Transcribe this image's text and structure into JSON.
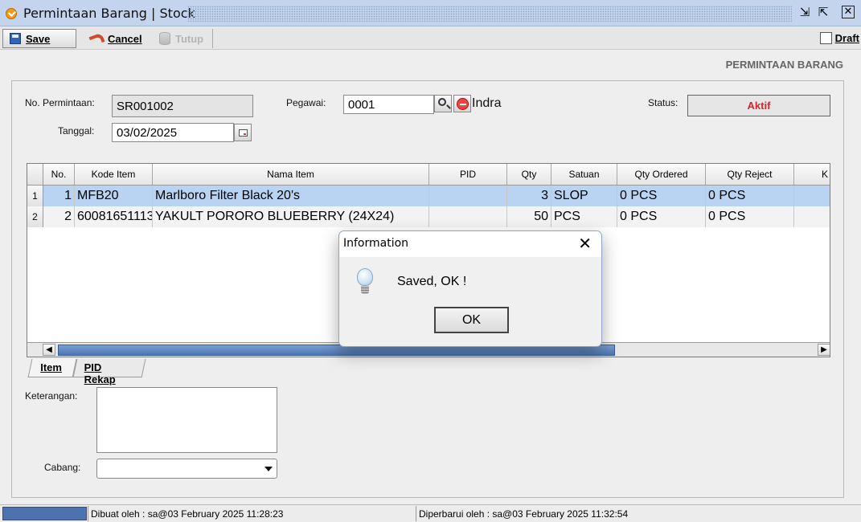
{
  "window": {
    "title": "Permintaan Barang | Stock"
  },
  "toolbar": {
    "save_label": "Save",
    "cancel_label": "Cancel",
    "tutup_label": "Tutup",
    "draft_label": "Draft"
  },
  "form": {
    "heading": "PERMINTAAN BARANG",
    "no_permintaan_label": "No. Permintaan:",
    "no_permintaan_value": "SR001002",
    "tanggal_label": "Tanggal:",
    "tanggal_value": "03/02/2025",
    "pegawai_label": "Pegawai:",
    "pegawai_value": "0001",
    "pegawai_name": "Indra",
    "status_label": "Status:",
    "status_value": "Aktif",
    "keterangan_label": "Keterangan:",
    "cabang_label": "Cabang:",
    "cabang_value": ""
  },
  "table": {
    "columns": [
      "No.",
      "Kode Item",
      "Nama Item",
      "PID",
      "Qty",
      "Satuan",
      "Qty Ordered",
      "Qty Reject",
      "K"
    ],
    "rows": [
      {
        "row_header": "1",
        "no": "1",
        "kode": "MFB20",
        "nama": "Marlboro Filter Black 20's",
        "pid": "",
        "qty": "3",
        "satuan": "SLOP",
        "qty_ordered": "0 PCS",
        "qty_reject": "0 PCS"
      },
      {
        "row_header": "2",
        "no": "2",
        "kode": "60081651113",
        "nama": "YAKULT PORORO BLUEBERRY (24X24)",
        "pid": "",
        "qty": "50",
        "satuan": "PCS",
        "qty_ordered": "0 PCS",
        "qty_reject": "0 PCS"
      }
    ]
  },
  "tabs": {
    "item": "Item",
    "pid_rekap": "PID Rekap"
  },
  "statusbar": {
    "dibuat": "Dibuat oleh : sa@03 February 2025  11:28:23",
    "diperbarui": "Diperbarui oleh : sa@03 February 2025  11:32:54"
  },
  "dialog": {
    "title": "Information",
    "message": "Saved, OK !",
    "ok_label": "OK",
    "close_glyph": "✕",
    "icon": "lightbulb-icon"
  },
  "colors": {
    "status_text": "#e0202a",
    "selected_row": "#b8d4f2",
    "titlebar": "#c3d4ec"
  }
}
